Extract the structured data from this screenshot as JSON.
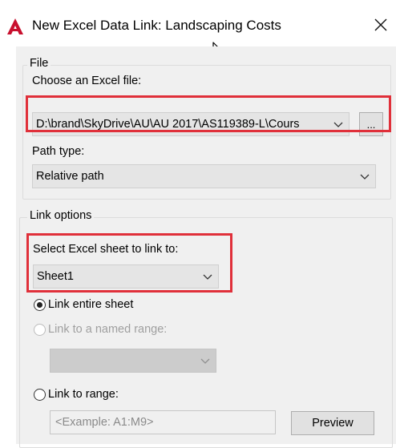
{
  "window": {
    "title": "New Excel Data Link: Landscaping Costs",
    "close_label": "✕"
  },
  "file_group": {
    "legend": "File",
    "choose_label": "Choose an Excel file:",
    "file_path": "D:\\brand\\SkyDrive\\AU\\AU 2017\\AS119389-L\\Cours",
    "browse_label": "...",
    "path_type_label": "Path type:",
    "path_type_value": "Relative path"
  },
  "link_group": {
    "legend": "Link options",
    "sheet_label": "Select Excel sheet to link to:",
    "sheet_value": "Sheet1",
    "radio_entire_sheet": "Link entire sheet",
    "radio_named_range": "Link to a named range:",
    "named_range_value": "",
    "radio_range": "Link to range:",
    "range_placeholder": "<Example: A1:M9>",
    "preview_label": "Preview",
    "selected": "entire_sheet"
  },
  "colors": {
    "highlight": "#e0303a",
    "app_icon": "#c8102e"
  }
}
